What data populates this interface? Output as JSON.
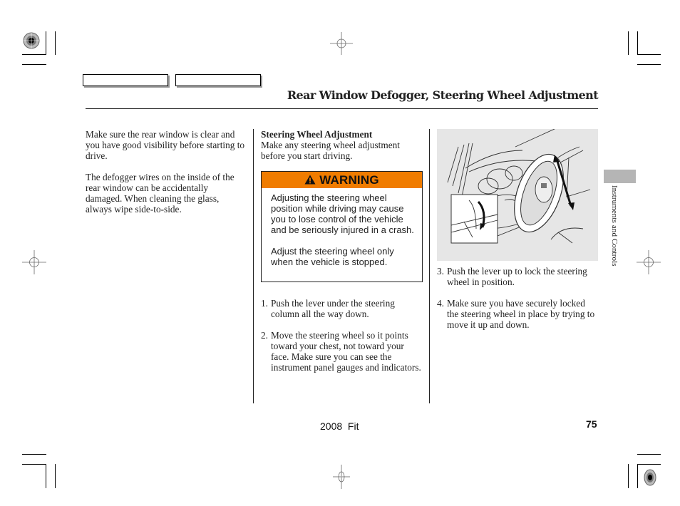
{
  "header": {
    "title": "Rear Window Defogger, Steering Wheel Adjustment"
  },
  "section_tab": {
    "label": "Instruments and Controls",
    "color": "#b5b5b5"
  },
  "column1": {
    "paragraphs": [
      "Make sure the rear window is clear and you have good visibility before starting to drive.",
      "The defogger wires on the inside of the rear window can be accidentally damaged. When cleaning the glass, always wipe side-to-side."
    ]
  },
  "column2": {
    "subheading": "Steering Wheel Adjustment",
    "intro": "Make any steering wheel adjustment before you start driving.",
    "warning": {
      "icon": "warning-triangle-icon",
      "label": "WARNING",
      "color": "#f07c00",
      "paragraphs": [
        "Adjusting the steering wheel position while driving may cause you to lose control of the vehicle and be seriously injured in a crash.",
        "Adjust the steering wheel only when the vehicle is stopped."
      ]
    },
    "steps": [
      {
        "num": "1.",
        "text": "Push the lever under the steering column all the way down."
      },
      {
        "num": "2.",
        "text": "Move the steering wheel so it points toward your chest, not toward your face. Make sure you can see the instrument panel gauges and indicators."
      }
    ]
  },
  "column3": {
    "figure": "steering-wheel-adjustment-illustration",
    "steps": [
      {
        "num": "3.",
        "text": "Push the lever up to lock the steering wheel in position."
      },
      {
        "num": "4.",
        "text": "Make sure you have securely locked the steering wheel in place by trying to move it up and down."
      }
    ]
  },
  "footer": {
    "model": "2008  Fit",
    "page_number": "75"
  }
}
